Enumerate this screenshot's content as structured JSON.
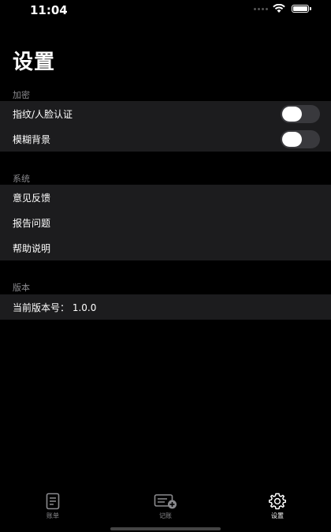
{
  "status_bar": {
    "time": "11:04",
    "icons": [
      "signal-dots",
      "wifi-icon",
      "battery-icon"
    ]
  },
  "page": {
    "title": "设置"
  },
  "sections": {
    "encryption": {
      "label": "加密",
      "items": [
        {
          "label": "指纹/人脸认证",
          "toggle": false
        },
        {
          "label": "模糊背景",
          "toggle": false
        }
      ]
    },
    "system": {
      "label": "系统",
      "items": [
        {
          "label": "意见反馈"
        },
        {
          "label": "报告问题"
        },
        {
          "label": "帮助说明"
        }
      ]
    },
    "version": {
      "label": "版本",
      "items": [
        {
          "label": "当前版本号：  1.0.0"
        }
      ]
    }
  },
  "tab_bar": {
    "tabs": [
      {
        "label": "账单",
        "icon": "bill-icon",
        "active": false
      },
      {
        "label": "记账",
        "icon": "add-record-icon",
        "active": false
      },
      {
        "label": "设置",
        "icon": "gear-icon",
        "active": true
      }
    ]
  },
  "colors": {
    "background": "#000000",
    "group_background": "#1c1c1e",
    "toggle_off": "#39393d",
    "secondary_text": "#8a8a8e"
  }
}
